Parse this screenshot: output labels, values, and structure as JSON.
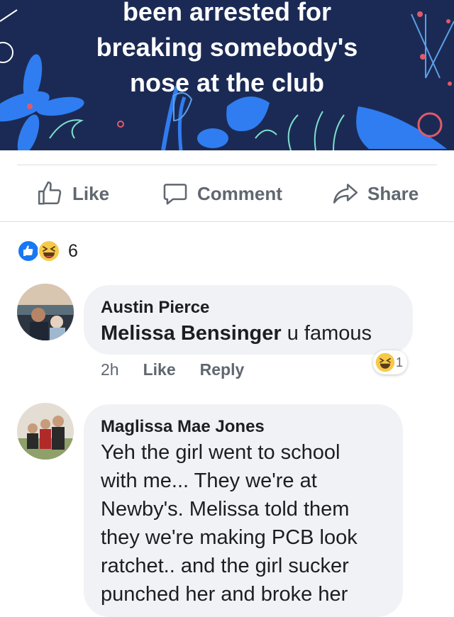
{
  "banner": {
    "lines": [
      "been arrested for",
      "breaking somebody's",
      "nose at the club"
    ],
    "bg": "#1b2a55"
  },
  "actions": {
    "like": "Like",
    "comment": "Comment",
    "share": "Share"
  },
  "reactions": {
    "types": [
      "like-icon",
      "haha-icon"
    ],
    "count": "6"
  },
  "comments": [
    {
      "author": "Austin Pierce",
      "mention": "Melissa Bensinger",
      "text": " u famous",
      "time": "2h",
      "like": "Like",
      "reply": "Reply",
      "reaction_count": "1"
    },
    {
      "author": "Maglissa Mae Jones",
      "lines": [
        "Yeh the girl went to school",
        "with me... They we're at",
        "Newby's. Melissa told them",
        "they we're making PCB look",
        "ratchet.. and the girl sucker",
        "punched her and broke her"
      ]
    }
  ],
  "colors": {
    "accent": "#1877f2",
    "text_secondary": "#606770",
    "bubble": "#f0f2f5"
  }
}
